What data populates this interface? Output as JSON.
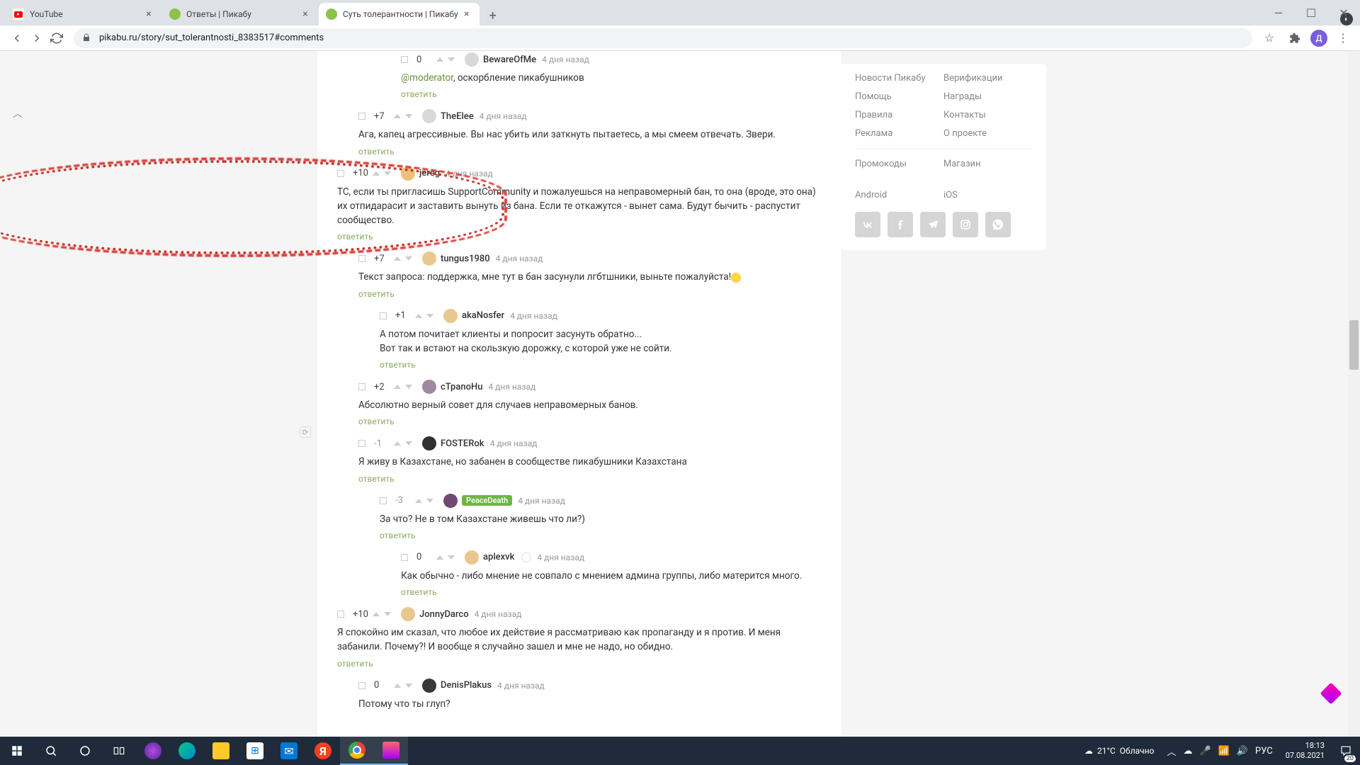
{
  "browser": {
    "tabs": [
      {
        "title": "YouTube",
        "favicon_color": "#ff0000"
      },
      {
        "title": "Ответы | Пикабу",
        "favicon_color": "#8bc24a"
      },
      {
        "title": "Суть толерантности | Пикабу",
        "favicon_color": "#8bc24a"
      }
    ],
    "url": "pikabu.ru/story/sut_tolerantnosti_8383517#comments",
    "profile_initial": "Д"
  },
  "sidebar": {
    "col1": [
      "Новости Пикабу",
      "Помощь",
      "Правила",
      "Реклама"
    ],
    "col2": [
      "Верификации",
      "Награды",
      "Контакты",
      "О проекте"
    ],
    "row2_col1": "Промокоды",
    "row2_col2": "Магазин",
    "platform1": "Android",
    "platform2": "iOS"
  },
  "comments": [
    {
      "lvl": 3,
      "rating": "0",
      "user": "BewareOfMe",
      "time": "4 дня назад",
      "text_prefix": "@moderator",
      "text": ", оскорбление пикабушников",
      "reply": "ответить",
      "avatar": "#d8d8d8",
      "collapse": true
    },
    {
      "lvl": 1,
      "rating": "+7",
      "user": "TheElee",
      "time": "4 дня назад",
      "text": "Ага, капец агрессивные. Вы нас убить или заткнуть пытаетесь, а мы смеем отвечать. Звери.",
      "reply": "ответить",
      "avatar": "#d8d8d8",
      "collapse": true
    },
    {
      "lvl": 0,
      "rating": "+10",
      "user": "jereg",
      "time": "4 дня назад",
      "text": "ТС, если ты пригласишь SupportCommunity и пожалуешься на неправомерный бан, то она (вроде, это она) их отпидарасит и заставить  вынуть из бана. Если те откажутся - вынет сама. Будут бычить - распустит сообщество.",
      "reply": "ответить",
      "avatar": "#f0c078",
      "highlighted": true,
      "collapse": true
    },
    {
      "lvl": 1,
      "rating": "+7",
      "user": "tungus1980",
      "time": "4 дня назад",
      "text": "Текст запроса: поддержка, мне тут в бан засунули лгбтшники, выньте пожалуйста!",
      "text_emoji": true,
      "reply": "ответить",
      "avatar": "#e8c890",
      "collapse": true
    },
    {
      "lvl": 2,
      "rating": "+1",
      "user": "akaNosfer",
      "time": "4 дня назад",
      "text": "А потом почитает клиенты и попросит засунуть обратно...\nВот так и встают на скользкую дорожку, с которой уже не сойти.",
      "reply": "ответить",
      "avatar": "#e8c890",
      "collapse": true
    },
    {
      "lvl": 1,
      "rating": "+2",
      "user": "cTpanoHu",
      "time": "4 дня назад",
      "text": "Абсолютно верный совет для случаев неправомерных банов.",
      "reply": "ответить",
      "avatar": "#a088a0",
      "collapse": true
    },
    {
      "lvl": 1,
      "rating": "-1",
      "rating_gray": true,
      "user": "FOSTERok",
      "time": "4 дня назад",
      "text": "Я живу в Казахстане, но забанен в сообществе пикабушники Казахстана",
      "reply": "ответить",
      "avatar": "#303030",
      "collapse": true
    },
    {
      "lvl": 2,
      "rating": "-3",
      "rating_gray": true,
      "user": "PeaceDeath",
      "user_green": true,
      "time": "4 дня назад",
      "text": "За что? Не в том Казахстане живешь что ли?)",
      "reply": "ответить",
      "avatar": "#704870",
      "collapse": true
    },
    {
      "lvl": 3,
      "rating": "0",
      "user": "aplexvk",
      "user_badge": true,
      "time": "4 дня назад",
      "text": "Как обычно - либо мнение не совпало с мнением админа группы, либо матерится много.",
      "reply": "ответить",
      "avatar": "#e8c890",
      "collapse": true
    },
    {
      "lvl": 0,
      "rating": "+10",
      "user": "JonnyDarco",
      "time": "4 дня назад",
      "text": "Я спокойно им сказал, что любое их действие я рассматриваю как пропаганду и я против. И меня забанили. Почему?! И вообще я случайно зашел и мне не надо, но обидно.",
      "reply": "ответить",
      "avatar": "#e8c890",
      "collapse": true
    },
    {
      "lvl": 1,
      "rating": "0",
      "user": "DenisPlakus",
      "time": "4 дня назад",
      "text": "Потому что ты глуп?",
      "reply": "",
      "avatar": "#383838",
      "collapse": true
    }
  ],
  "taskbar": {
    "weather_temp": "21°C",
    "weather_text": "Облачно",
    "lang": "РУС",
    "time": "18:13",
    "date": "07.08.2021",
    "notif_count": "20"
  }
}
